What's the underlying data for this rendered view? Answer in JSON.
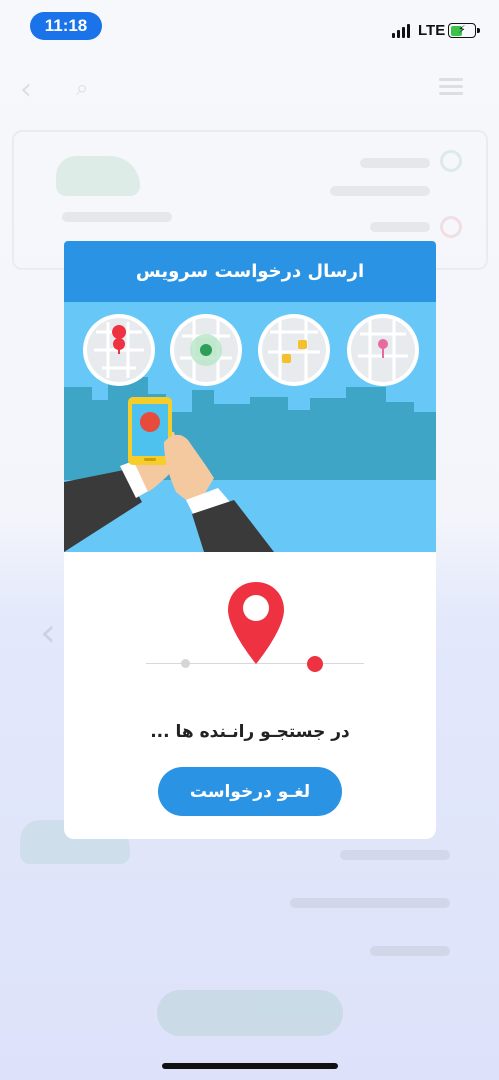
{
  "status_bar": {
    "time": "11:18",
    "network": "LTE",
    "battery_level": 0.45,
    "time_pill_color": "#1a73e8",
    "battery_color": "#3cc24a"
  },
  "modal": {
    "title": "ارسال درخواست سرویس",
    "status_text": "در جستجـو رانـنده ها ...",
    "cancel_label": "لغـو درخواست",
    "header_color": "#2b93e3",
    "pin_color": "#ee3241"
  },
  "icons": {
    "back": "chevron-left-icon",
    "search": "search-icon",
    "menu": "hamburger-menu-icon",
    "pin": "location-pin-icon"
  }
}
